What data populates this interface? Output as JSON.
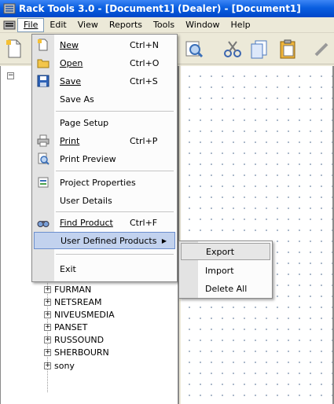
{
  "window": {
    "title": "Rack Tools 3.0 - [Document1] (Dealer) - [Document1]"
  },
  "menubar": {
    "items": [
      {
        "label": "File"
      },
      {
        "label": "Edit"
      },
      {
        "label": "View"
      },
      {
        "label": "Reports"
      },
      {
        "label": "Tools"
      },
      {
        "label": "Window"
      },
      {
        "label": "Help"
      }
    ]
  },
  "file_menu": {
    "items": [
      {
        "label": "New",
        "shortcut": "Ctrl+N",
        "icon": "new-document-icon"
      },
      {
        "label": "Open",
        "shortcut": "Ctrl+O",
        "icon": "open-folder-icon"
      },
      {
        "label": "Save",
        "shortcut": "Ctrl+S",
        "icon": "save-disk-icon"
      },
      {
        "label": "Save As",
        "shortcut": ""
      },
      {
        "label": "Page Setup",
        "shortcut": ""
      },
      {
        "label": "Print",
        "shortcut": "Ctrl+P",
        "icon": "printer-icon"
      },
      {
        "label": "Print Preview",
        "shortcut": "",
        "icon": "print-preview-icon"
      },
      {
        "label": "Project Properties",
        "shortcut": "",
        "icon": "properties-icon"
      },
      {
        "label": "User Details",
        "shortcut": ""
      },
      {
        "label": "Find Product",
        "shortcut": "Ctrl+F",
        "icon": "binoculars-icon"
      },
      {
        "label": "User Defined Products",
        "shortcut": ""
      },
      {
        "label": "Exit",
        "shortcut": ""
      }
    ]
  },
  "submenu": {
    "items": [
      {
        "label": "Export"
      },
      {
        "label": "Import"
      },
      {
        "label": "Delete All"
      }
    ]
  },
  "tree": {
    "root_toggle": "−",
    "expand_symbol": "+",
    "items": [
      "FURMAN",
      "NETSREAM",
      "NIVEUSMEDIA",
      "PANSET",
      "RUSSOUND",
      "SHERBOURN",
      "sony"
    ]
  },
  "colors": {
    "title_bar": "#0a5ee0",
    "highlight": "#c2d2ee",
    "menu_gutter": "#e3e3e3"
  }
}
